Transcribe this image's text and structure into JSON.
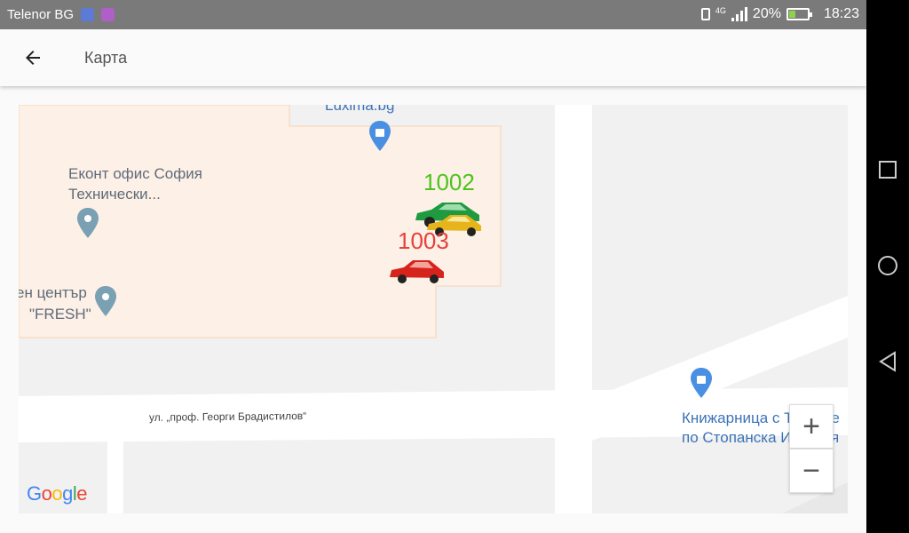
{
  "status_bar": {
    "carrier": "Telenor BG",
    "network": "4G",
    "battery": "20%",
    "time": "18:23"
  },
  "app_bar": {
    "title": "Карта",
    "back_icon": "arrow-left-icon"
  },
  "map": {
    "labels": {
      "luxima": "Luxima.bg",
      "econt_line1": "Еконт офис София",
      "econt_line2": "Технически...",
      "fresh_line1": "ен център",
      "fresh_line2": "\"FRESH\"",
      "street": "ул. „проф. Георги Брадистилов“",
      "bookstore_line1": "Книжарница с Тестове",
      "bookstore_line2": "по Стопанска История"
    },
    "vehicles": [
      {
        "label": "1002",
        "color": "#4cc41c"
      },
      {
        "label": "1003",
        "color": "#e8403a"
      }
    ],
    "zoom_in": "+",
    "zoom_out": "−",
    "logo": "Google"
  },
  "colors": {
    "building_fill": "#fdf0e6",
    "building_stroke": "#f6d3b4",
    "road": "#ffffff",
    "poi_blue": "#4a90e2",
    "pin_grey": "#7aa0b4"
  }
}
